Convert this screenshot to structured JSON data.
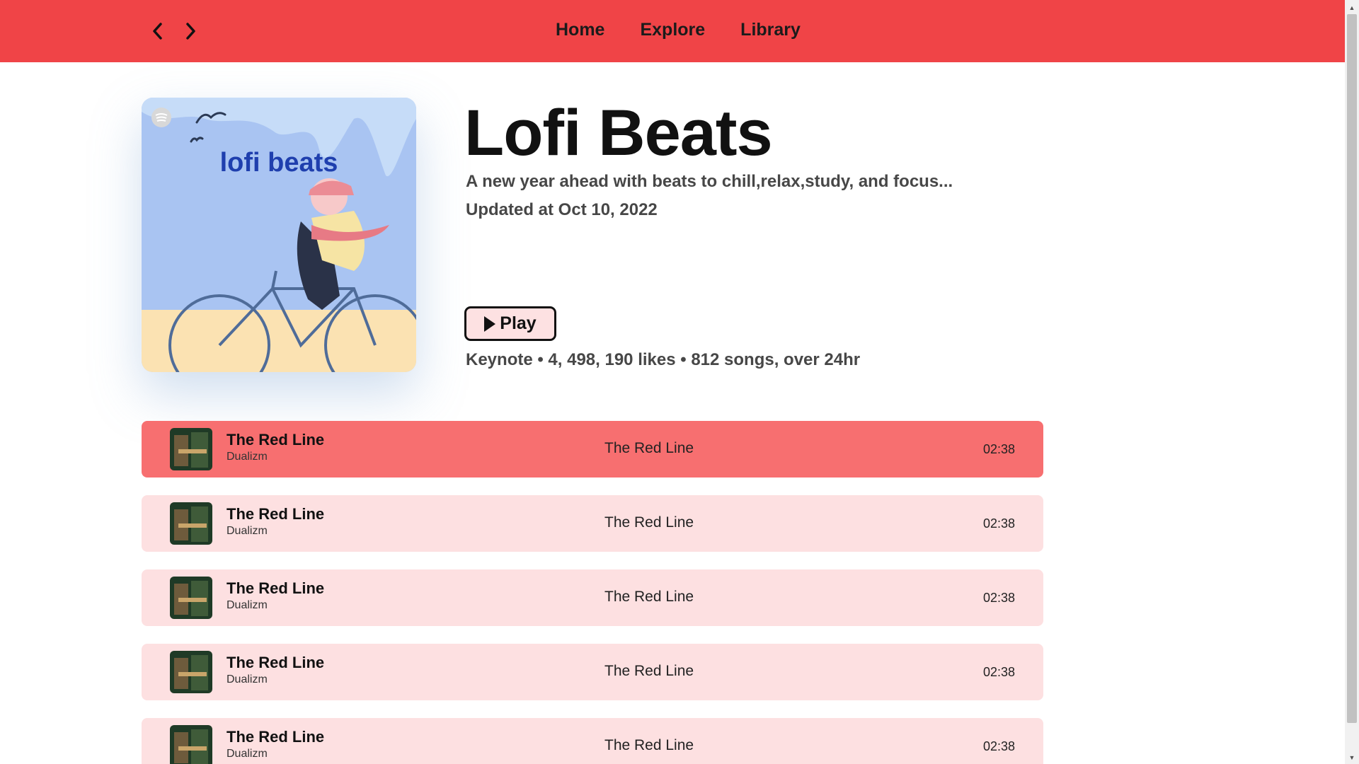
{
  "nav": {
    "back_icon": "chevron-left-icon",
    "forward_icon": "chevron-right-icon",
    "links": [
      "Home",
      "Explore",
      "Library"
    ]
  },
  "playlist": {
    "cover_text": "lofi beats",
    "title": "Lofi Beats",
    "description": "A new year ahead with beats to chill,relax,study, and focus...",
    "updated": "Updated at Oct 10, 2022",
    "play_label": "Play",
    "stats": "Keynote • 4, 498, 190 likes • 812 songs, over 24hr"
  },
  "tracks": [
    {
      "title": "The Red Line",
      "artist": "Dualizm",
      "album": "The Red Line",
      "duration": "02:38",
      "active": true
    },
    {
      "title": "The Red Line",
      "artist": "Dualizm",
      "album": "The Red Line",
      "duration": "02:38",
      "active": false
    },
    {
      "title": "The Red Line",
      "artist": "Dualizm",
      "album": "The Red Line",
      "duration": "02:38",
      "active": false
    },
    {
      "title": "The Red Line",
      "artist": "Dualizm",
      "album": "The Red Line",
      "duration": "02:38",
      "active": false
    },
    {
      "title": "The Red Line",
      "artist": "Dualizm",
      "album": "The Red Line",
      "duration": "02:38",
      "active": false
    }
  ],
  "colors": {
    "topbar": "#f04447",
    "track_active": "#f76f70",
    "track_bg": "#fde0e1"
  }
}
